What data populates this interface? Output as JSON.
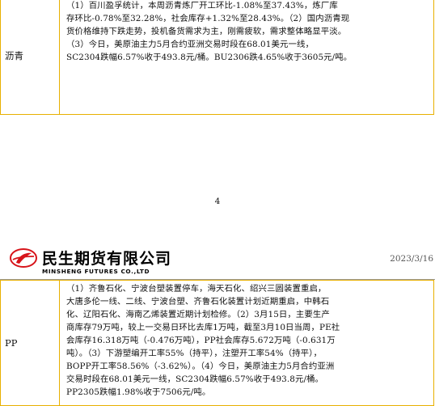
{
  "section1": {
    "label": "沥青",
    "lines": [
      "（1）百川盈孚统计，本周沥青炼厂开工环比-1.08%至37.43%，炼厂库",
      "存环比-0.78%至32.28%，社会库存+1.32%至28.43%。（2）国内沥青现",
      "货价格维持下跌走势，投机备货需求为主，刚需疲软，需求整体略显平淡。",
      "（3）今日，美原油主力5月合约亚洲交易时段在68.01美元一线，",
      "SC2304跌幅6.57%收于493.8元/桶。BU2306跌4.65%收于3605元/吨。"
    ]
  },
  "page_number": "4",
  "header": {
    "company_cn": "民生期货有限公司",
    "company_en": "MINSHENG FUTURES CO.,LTD",
    "date": "2023/3/16"
  },
  "section2": {
    "label": "PP",
    "lines": [
      "（1）齐鲁石化、宁波台塑装置停车，海天石化、绍兴三圆装置重启，",
      "大唐多伦一线、二线、宁波台塑、齐鲁石化装置计划近期重启，中韩石",
      "化、辽阳石化、海南乙烯装置近期计划检修。（2）3月15日，主要生产",
      "商库存79万吨，较上一交易日环比去库1万吨，截至3月10日当周，PE社",
      "会库存16.318万吨（-0.476万吨），PP社会库存5.672万吨（-0.631万",
      "吨）。（3）下游塑编开工率55%（持平），注塑开工率54%（持平），",
      "BOPP开工率58.56%（-3.62%）。（4）今日，美原油主力5月合约亚洲",
      "交易时段在68.01美元一线，SC2304跌幅6.57%收于493.8元/桶。",
      "PP2305跌幅1.98%收于7506元/吨。"
    ]
  },
  "colors": {
    "border": "#e8b000",
    "logo_red": "#d7141a"
  }
}
